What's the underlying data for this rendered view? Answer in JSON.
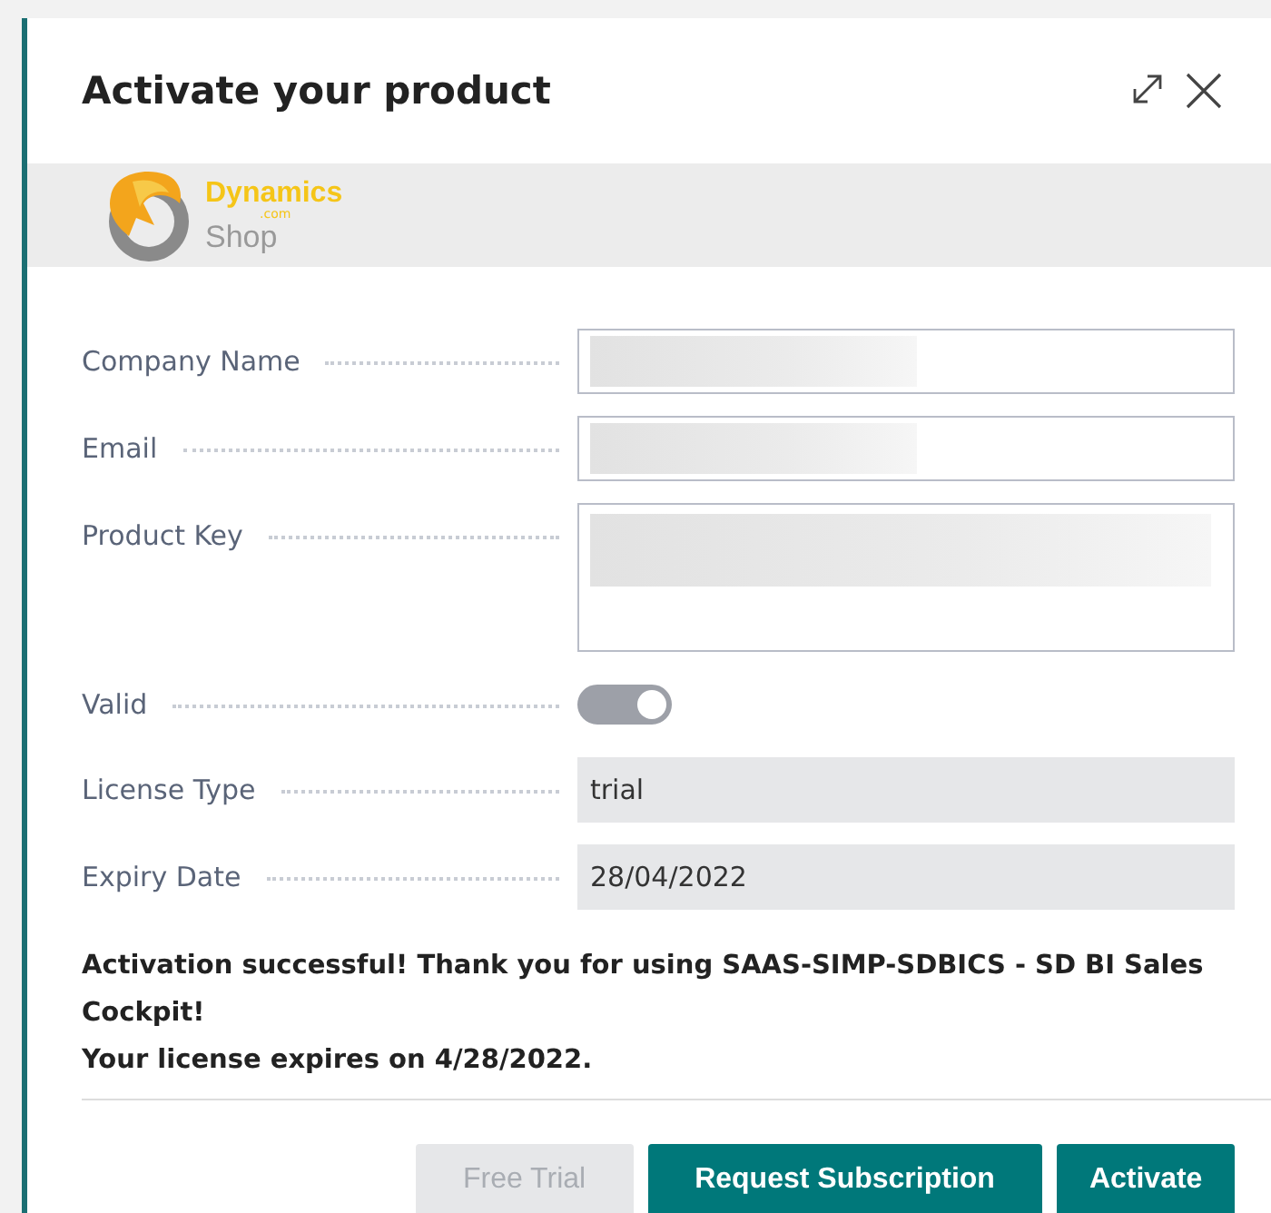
{
  "dialog": {
    "title": "Activate your product"
  },
  "logo": {
    "brand": "Dynamics",
    "domain": ".com",
    "word": "Shop"
  },
  "fields": [
    {
      "label": "Company Name",
      "kind": "input",
      "blurred": true
    },
    {
      "label": "Email",
      "kind": "input",
      "blurred": true
    },
    {
      "label": "Product Key",
      "kind": "textarea",
      "blurred": true
    },
    {
      "label": "Valid",
      "kind": "toggle",
      "on": true
    },
    {
      "label": "License Type",
      "kind": "readonly",
      "value": "trial"
    },
    {
      "label": "Expiry Date",
      "kind": "readonly",
      "value": "28/04/2022"
    }
  ],
  "message": [
    "Activation successful! Thank you for using SAAS-SIMP-SDBICS - SD BI Sales Cockpit!",
    "Your license expires on 4/28/2022."
  ],
  "buttons": [
    {
      "label": "Free Trial",
      "disabled": true
    },
    {
      "label": "Request Subscription",
      "disabled": false
    },
    {
      "label": "Activate",
      "disabled": false
    }
  ]
}
